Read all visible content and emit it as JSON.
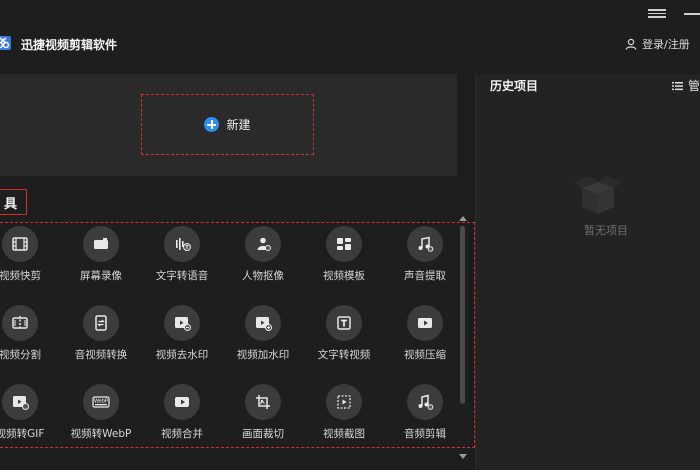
{
  "app": {
    "title": "迅捷视频剪辑软件",
    "login": "登录/注册"
  },
  "main": {
    "new_label": "新建",
    "section_title": "具"
  },
  "tools": [
    {
      "label": "视频快剪",
      "icon": "film-icon"
    },
    {
      "label": "屏幕录像",
      "icon": "camera-icon"
    },
    {
      "label": "文字转语音",
      "icon": "text-to-speech-icon"
    },
    {
      "label": "人物抠像",
      "icon": "person-cutout-icon"
    },
    {
      "label": "视频模板",
      "icon": "template-icon"
    },
    {
      "label": "声音提取",
      "icon": "audio-extract-icon"
    },
    {
      "label": "视频分割",
      "icon": "split-video-icon"
    },
    {
      "label": "音视频转换",
      "icon": "av-convert-icon"
    },
    {
      "label": "视频去水印",
      "icon": "remove-watermark-icon"
    },
    {
      "label": "视频加水印",
      "icon": "add-watermark-icon"
    },
    {
      "label": "文字转视频",
      "icon": "text-to-video-icon"
    },
    {
      "label": "视频压缩",
      "icon": "compress-video-icon"
    },
    {
      "label": "视频转GIF",
      "icon": "gif-icon"
    },
    {
      "label": "视频转WebP",
      "icon": "webp-icon",
      "badge": "WebP"
    },
    {
      "label": "视频合并",
      "icon": "merge-video-icon"
    },
    {
      "label": "画面裁切",
      "icon": "crop-icon"
    },
    {
      "label": "视频截图",
      "icon": "screenshot-icon"
    },
    {
      "label": "音频剪辑",
      "icon": "audio-edit-icon"
    }
  ],
  "history": {
    "title": "历史项目",
    "manage": "管",
    "empty": "暂无项目"
  },
  "colors": {
    "accent": "#2f8ff0",
    "highlight": "#d0302c",
    "background": "#1c1c1c"
  }
}
